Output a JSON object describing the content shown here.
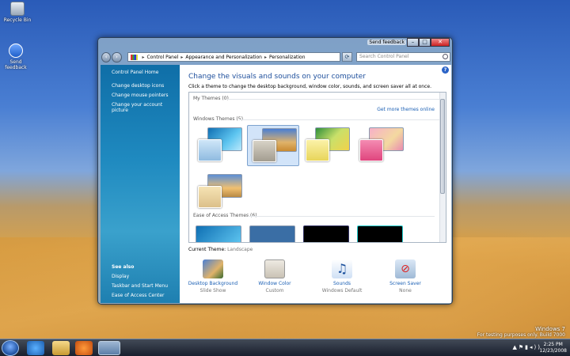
{
  "desktop": {
    "icons": [
      {
        "label": "Recycle Bin"
      },
      {
        "label": "Send\nfeedback"
      }
    ],
    "watermark": {
      "os": "Windows 7",
      "build": "For testing purposes only. Build 7000"
    }
  },
  "window": {
    "send_feedback": "Send feedback",
    "controls": {
      "minimize": "–",
      "maximize": "□",
      "close": "✕"
    },
    "breadcrumb": [
      "Control Panel",
      "Appearance and Personalization",
      "Personalization"
    ],
    "search_placeholder": "Search Control Panel",
    "left_pane": {
      "home": "Control Panel Home",
      "links": [
        "Change desktop icons",
        "Change mouse pointers",
        "Change your account picture"
      ],
      "see_also_title": "See also",
      "see_also": [
        "Display",
        "Taskbar and Start Menu",
        "Ease of Access Center"
      ]
    },
    "main": {
      "title": "Change the visuals and sounds on your computer",
      "subtitle": "Click a theme to change the desktop background, window color, sounds, and screen saver all at once.",
      "my_themes": "My Themes (0)",
      "get_more": "Get more themes online",
      "windows_themes": "Windows Themes (5)",
      "ease_themes": "Ease of Access Themes (6)",
      "current_label": "Current Theme:",
      "current_value": "Landscape"
    },
    "bottom": [
      {
        "label": "Desktop Background",
        "value": "Slide Show"
      },
      {
        "label": "Window Color",
        "value": "Custom"
      },
      {
        "label": "Sounds",
        "value": "Windows Default"
      },
      {
        "label": "Screen Saver",
        "value": "None"
      }
    ]
  },
  "taskbar": {
    "time": "2:25 PM",
    "date": "12/23/2008"
  },
  "colors": {
    "link": "#1a5fb4",
    "heading": "#1e4f9c",
    "left_pane": "#1f8ac0"
  }
}
